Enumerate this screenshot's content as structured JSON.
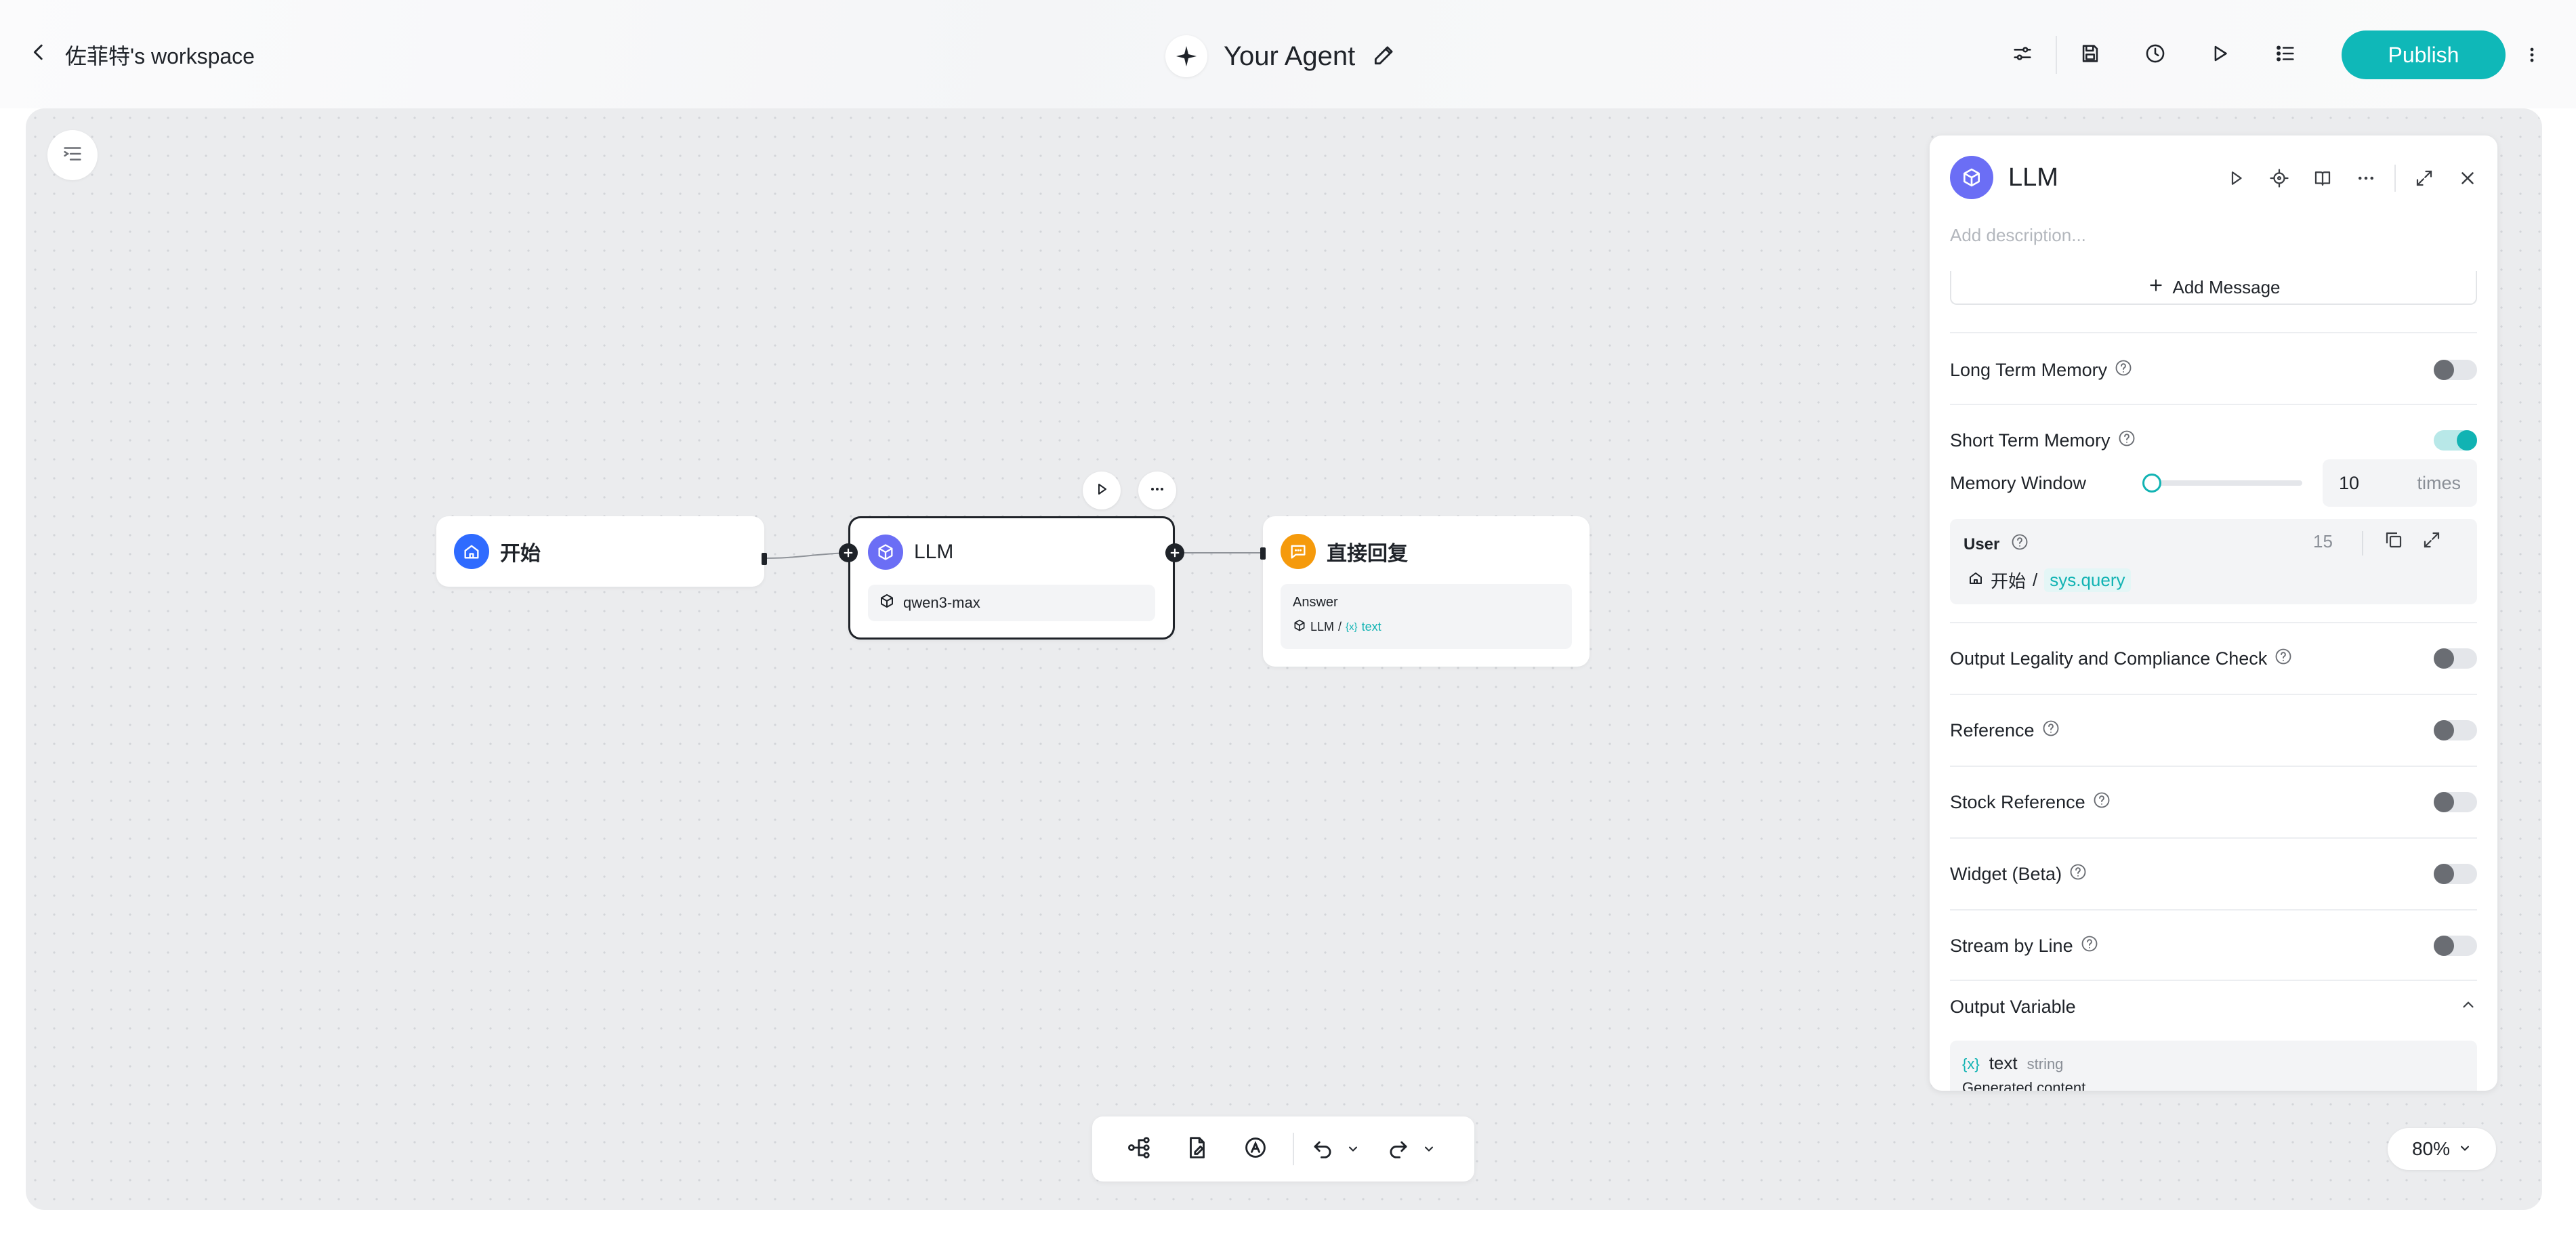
{
  "header": {
    "back_label": "佐菲特's workspace",
    "agent_title": "Your Agent",
    "publish_label": "Publish",
    "icons": [
      "workflow-settings-icon",
      "save-icon",
      "history-icon",
      "run-icon",
      "checklist-icon",
      "more-vertical-icon"
    ]
  },
  "canvas": {
    "nodes": {
      "start": {
        "title": "开始",
        "icon": "home-icon",
        "color": "#2f6bff"
      },
      "llm": {
        "title": "LLM",
        "icon": "cube-icon",
        "color": "#6b6ef5",
        "model": "qwen3-max"
      },
      "reply": {
        "title": "直接回复",
        "icon": "message-icon",
        "color": "#f59a0c",
        "answer_label": "Answer",
        "ref_node": "LLM",
        "ref_sep": "/",
        "ref_var_icon": "{x}",
        "ref_var": "text"
      }
    },
    "zoom": "80%"
  },
  "panel": {
    "title": "LLM",
    "description_placeholder": "Add description...",
    "add_message": "Add Message",
    "long_term_memory": {
      "label": "Long Term Memory",
      "enabled": false
    },
    "short_term_memory": {
      "label": "Short Term Memory",
      "enabled": true
    },
    "memory_window": {
      "label": "Memory Window",
      "value": "10",
      "unit": "times",
      "slider_fraction": 0.0
    },
    "user_prompt": {
      "label": "User",
      "count": "15",
      "ref_node": "开始",
      "ref_sep": "/",
      "ref_var": "sys.query"
    },
    "toggles": [
      {
        "label": "Output Legality and Compliance Check",
        "enabled": false
      },
      {
        "label": "Reference",
        "enabled": false
      },
      {
        "label": "Stock Reference",
        "enabled": false
      },
      {
        "label": "Widget (Beta)",
        "enabled": false
      },
      {
        "label": "Stream by Line",
        "enabled": false
      }
    ],
    "output_variable": {
      "label": "Output Variable",
      "var_icon": "{x}",
      "name": "text",
      "type": "string",
      "description": "Generated content"
    }
  },
  "colors": {
    "accent": "#0fb8b8",
    "dark": "#1f2329"
  }
}
